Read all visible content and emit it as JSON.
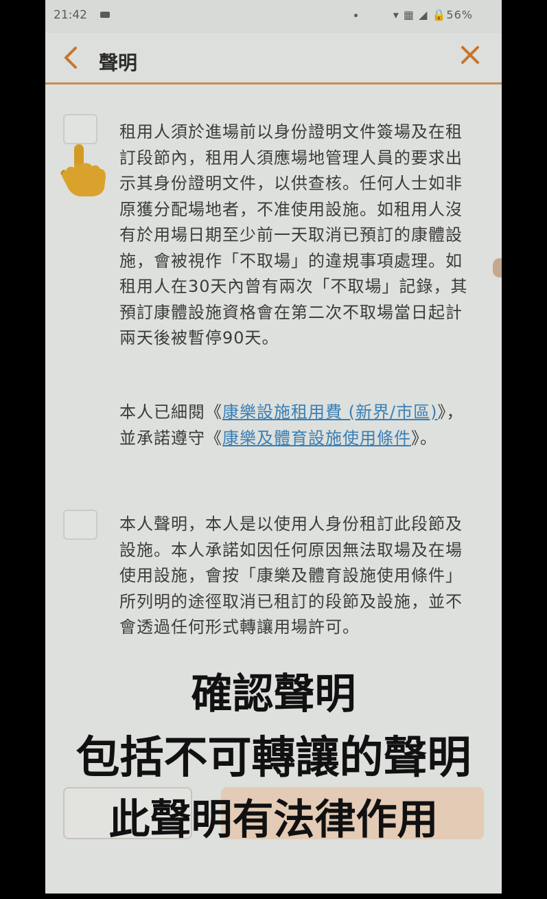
{
  "status_bar": {
    "time": "21:42",
    "indicators": "▾ ▦ ◢ 🔒56%"
  },
  "header": {
    "title": "聲明",
    "back_icon": "chevron-left-icon",
    "close_icon": "close-icon"
  },
  "declaration1": {
    "checked": false,
    "text": "租用人須於進場前以身份證明文件簽場及在租訂段節內，租用人須應場地管理人員的要求出示其身份證明文件，以供查核。任何人士如非原獲分配場地者，不准使用設施。如租用人沒有於用場日期至少前一天取消已預訂的康體設施，會被視作「不取場」的違規事項處理。如租用人在30天內曾有兩次「不取場」記錄，其預訂康體設施資格會在第二次不取場當日起計兩天後被暫停90天。",
    "ack_prefix": "本人已細閱《",
    "link1": "康樂設施租用費 (新界/市區)",
    "ack_middle": "》，並承諾遵守《",
    "link2": "康樂及體育設施使用條件",
    "ack_suffix": "》。"
  },
  "declaration2": {
    "checked": false,
    "text": "本人聲明，本人是以使用人身份租訂此段節及設施。本人承諾如因任何原因無法取場及在場使用設施，會按「康樂及體育設施使用條件」所列明的途徑取消已租訂的段節及設施，並不會透過任何形式轉讓用場許可。"
  },
  "overlay_captions": {
    "line1": "確認聲明",
    "line2": "包括不可轉讓的聲明",
    "line3": "此聲明有法律作用"
  },
  "colors": {
    "accent": "#c8742d",
    "link": "#3a7fb6",
    "background": "#dde0dc"
  }
}
